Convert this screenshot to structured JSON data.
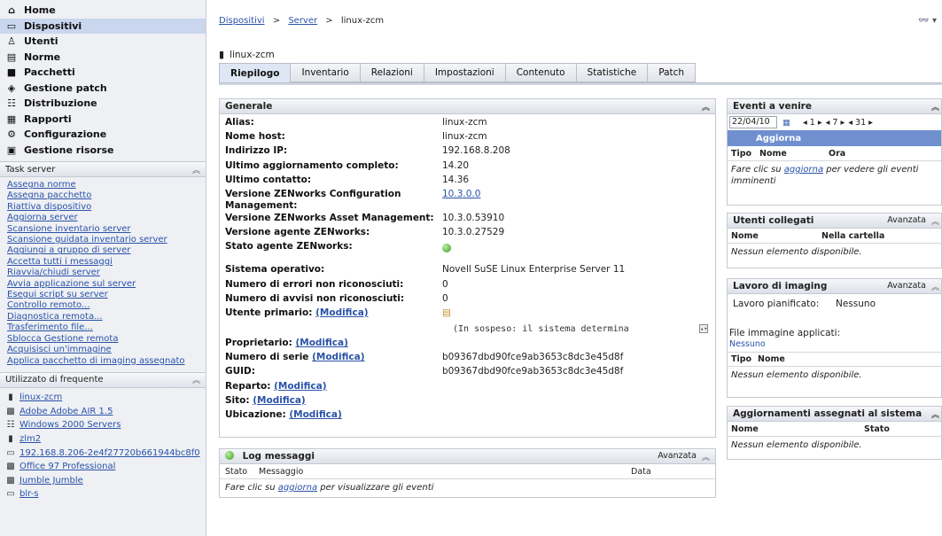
{
  "nav": [
    {
      "label": "Home",
      "icon": "home-icon",
      "glyph": "⌂",
      "active": false
    },
    {
      "label": "Dispositivi",
      "icon": "devices-icon",
      "glyph": "▭",
      "active": true
    },
    {
      "label": "Utenti",
      "icon": "users-icon",
      "glyph": "♙",
      "active": false
    },
    {
      "label": "Norme",
      "icon": "policies-icon",
      "glyph": "▤",
      "active": false
    },
    {
      "label": "Pacchetti",
      "icon": "bundles-icon",
      "glyph": "■",
      "active": false
    },
    {
      "label": "Gestione patch",
      "icon": "patch-icon",
      "glyph": "◈",
      "active": false
    },
    {
      "label": "Distribuzione",
      "icon": "deployment-icon",
      "glyph": "☷",
      "active": false
    },
    {
      "label": "Rapporti",
      "icon": "reports-icon",
      "glyph": "▦",
      "active": false
    },
    {
      "label": "Configurazione",
      "icon": "configuration-icon",
      "glyph": "⚙",
      "active": false
    },
    {
      "label": "Gestione risorse",
      "icon": "asset-icon",
      "glyph": "▣",
      "active": false
    }
  ],
  "task_server": {
    "title": "Task server",
    "items": [
      "Assegna norme",
      "Assegna pacchetto",
      "Riattiva dispositivo",
      "Aggiorna server",
      "Scansione inventario server",
      "Scansione guidata inventario server",
      "Aggiungi a gruppo di server",
      "Accetta tutti i messaggi",
      "Riavvia/chiudi server",
      "Avvia applicazione sul server",
      "Esegui script su server",
      "Controllo remoto...",
      "Diagnostica remota...",
      "Trasferimento file...",
      "Sblocca Gestione remota",
      "Acquisisci un'immagine",
      "Applica pacchetto di imaging assegnato"
    ]
  },
  "frequent": {
    "title": "Utilizzato di frequente",
    "items": [
      {
        "label": "linux-zcm",
        "icon": "server-icon",
        "glyph": "▮"
      },
      {
        "label": "Adobe Adobe AIR 1.5",
        "icon": "bundle-icon",
        "glyph": "▩"
      },
      {
        "label": "Windows 2000 Servers",
        "icon": "group-icon",
        "glyph": "☷"
      },
      {
        "label": "zlm2",
        "icon": "server-icon",
        "glyph": "▮"
      },
      {
        "label": "192.168.8.206-2e4f27720b661944bc8f0",
        "icon": "workstation-icon",
        "glyph": "▭"
      },
      {
        "label": "Office 97 Professional",
        "icon": "bundle-icon",
        "glyph": "▩"
      },
      {
        "label": "Jumble Jumble",
        "icon": "bundle-icon",
        "glyph": "▩"
      },
      {
        "label": "blr-s",
        "icon": "workstation-icon",
        "glyph": "▭"
      }
    ]
  },
  "breadcrumb": {
    "a": "Dispositivi",
    "sep1": ">",
    "b": "Server",
    "sep2": ">",
    "c": "linux-zcm"
  },
  "topright": "👓 ▾",
  "device_title": "linux-zcm",
  "tabs": [
    "Riepilogo",
    "Inventario",
    "Relazioni",
    "Impostazioni",
    "Contenuto",
    "Statistiche",
    "Patch"
  ],
  "generale": {
    "title": "Generale",
    "rows": [
      {
        "label": "Alias:",
        "value": "linux-zcm"
      },
      {
        "label": "Nome host:",
        "value": "linux-zcm"
      },
      {
        "label": "Indirizzo IP:",
        "value": "192.168.8.208"
      },
      {
        "label": "Ultimo aggiornamento completo:",
        "value": "14.20"
      },
      {
        "label": "Ultimo contatto:",
        "value": "14.36"
      },
      {
        "label": "Versione ZENworks Configuration Management:",
        "value": "10.3.0.0",
        "link": true
      },
      {
        "label": "Versione ZENworks Asset Management:",
        "value": "10.3.0.53910"
      },
      {
        "label": "Versione agente ZENworks:",
        "value": "10.3.0.27529"
      },
      {
        "label": "Stato agente ZENworks:",
        "value": "",
        "dot": true
      },
      {
        "label": "Sistema operativo:",
        "value": "Novell SuSE Linux Enterprise Server 11"
      },
      {
        "label": "Numero di errori non riconosciuti:",
        "value": "0"
      },
      {
        "label": "Numero di avvisi non riconosciuti:",
        "value": "0"
      }
    ],
    "utente_label": "Utente primario:",
    "modifica": "(Modifica)",
    "utente_pending": "(In sospeso: il sistema determina",
    "rows2": [
      {
        "label": "Proprietario:",
        "value": ""
      },
      {
        "label": "Numero di serie",
        "value": "b09367dbd90fce9ab3653c8dc3e45d8f"
      },
      {
        "label": "GUID:",
        "value": "b09367dbd90fce9ab3653c8dc3e45d8f"
      },
      {
        "label": "Reparto:",
        "value": ""
      },
      {
        "label": "Sito:",
        "value": ""
      },
      {
        "label": "Ubicazione:",
        "value": ""
      }
    ]
  },
  "log": {
    "title": "Log messaggi",
    "avanzata": "Avanzata",
    "col_stato": "Stato",
    "col_messaggio": "Messaggio",
    "col_data": "Data",
    "msg_pre": "Fare clic su ",
    "msg_link": "aggiorna",
    "msg_post": " per visualizzare gli eventi"
  },
  "eventi": {
    "title": "Eventi a venire",
    "date": "22/04/10",
    "nav1": "◂ 1 ▸",
    "nav2": "◂ 7 ▸",
    "nav3": "◂ 31 ▸",
    "aggiorna": "Aggiorna",
    "col_tipo": "Tipo",
    "col_nome": "Nome",
    "col_ora": "Ora",
    "msg_pre": "Fare clic su ",
    "msg_link": "aggiorna",
    "msg_post": " per vedere gli eventi imminenti"
  },
  "utenti": {
    "title": "Utenti collegati",
    "avanzata": "Avanzata",
    "col_nome": "Nome",
    "col_cartella": "Nella cartella",
    "empty": "Nessun elemento disponibile."
  },
  "imaging": {
    "title": "Lavoro di imaging",
    "avanzata": "Avanzata",
    "pianificato_label": "Lavoro pianificato:",
    "pianificato_value": "Nessuno",
    "file_label": "File immagine applicati:",
    "file_value": "Nessuno",
    "col_tipo": "Tipo",
    "col_nome": "Nome",
    "empty": "Nessun elemento disponibile."
  },
  "aggiornamenti": {
    "title": "Aggiornamenti assegnati al sistema",
    "col_nome": "Nome",
    "col_stato": "Stato",
    "empty": "Nessun elemento disponibile."
  },
  "colors": {
    "accent": "#2a52a8",
    "active_nav": "#c9d6ee",
    "aggiorna_bar": "#6f8fcf",
    "status_ok": "#3a9a22"
  }
}
